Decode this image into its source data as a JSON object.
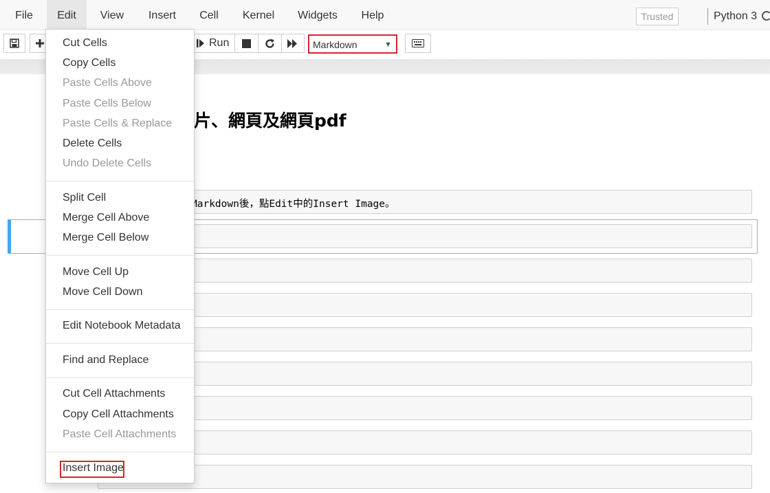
{
  "menubar": {
    "items": [
      "File",
      "Edit",
      "View",
      "Insert",
      "Cell",
      "Kernel",
      "Widgets",
      "Help"
    ],
    "trusted": "Trusted",
    "kernel": "Python 3"
  },
  "toolbar": {
    "run_label": "Run",
    "cell_type": "Markdown",
    "highlight_color": "#d9232d"
  },
  "notebook": {
    "title": "片、網頁及網頁pdf",
    "first_cell_text": "Markdown後，點Edit中的Insert Image。",
    "selected_cell_color": "#42a5f5"
  },
  "edit_menu": {
    "items": [
      {
        "label": "Cut Cells",
        "disabled": false
      },
      {
        "label": "Copy Cells",
        "disabled": false
      },
      {
        "label": "Paste Cells Above",
        "disabled": true
      },
      {
        "label": "Paste Cells Below",
        "disabled": true
      },
      {
        "label": "Paste Cells & Replace",
        "disabled": true
      },
      {
        "label": "Delete Cells",
        "disabled": false
      },
      {
        "label": "Undo Delete Cells",
        "disabled": true
      },
      {
        "label": "Split Cell",
        "disabled": false
      },
      {
        "label": "Merge Cell Above",
        "disabled": false
      },
      {
        "label": "Merge Cell Below",
        "disabled": false
      },
      {
        "label": "Move Cell Up",
        "disabled": false
      },
      {
        "label": "Move Cell Down",
        "disabled": false
      },
      {
        "label": "Edit Notebook Metadata",
        "disabled": false
      },
      {
        "label": "Find and Replace",
        "disabled": false
      },
      {
        "label": "Cut Cell Attachments",
        "disabled": false
      },
      {
        "label": "Copy Cell Attachments",
        "disabled": false
      },
      {
        "label": "Paste Cell Attachments",
        "disabled": true
      },
      {
        "label": "Insert Image",
        "disabled": false
      }
    ]
  }
}
